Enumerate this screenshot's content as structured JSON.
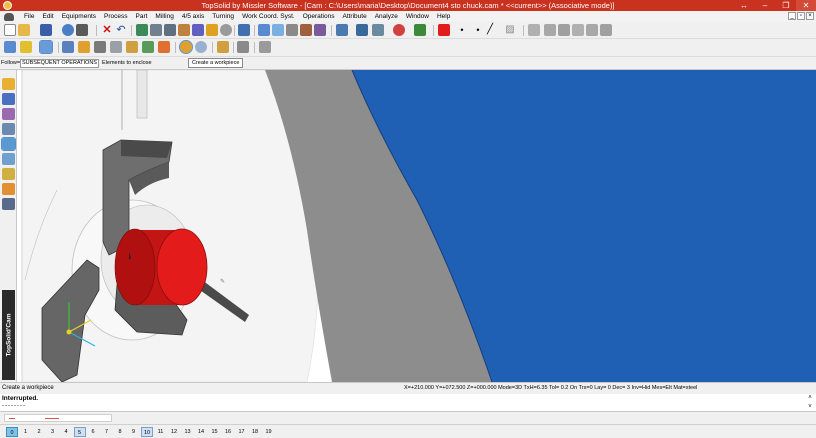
{
  "window": {
    "title": "TopSolid by Missler Software - [Cam : C:\\Users\\maria\\Desktop\\Document4 sto chuck.cam *  <<current>> (Associative mode)]",
    "controls": [
      "↔",
      "–",
      "❐",
      "✕"
    ]
  },
  "menu": {
    "items": [
      "File",
      "Edit",
      "Equipments",
      "Process",
      "Part",
      "Milling",
      "4/5 axis",
      "Turning",
      "Work Coord. Syst.",
      "Operations",
      "Attribute",
      "Analyze",
      "Window",
      "Help"
    ],
    "mdi_controls": [
      "_",
      "▫",
      "×"
    ]
  },
  "toolbar1": {
    "icons": [
      "new-file-icon",
      "open-folder-icon",
      "save-icon",
      "print-icon",
      "properties-icon",
      "delete-icon",
      "undo-icon",
      "redo-icon",
      "zoom-icon",
      "tools-icon",
      "wrench-icon",
      "eraser-icon",
      "attributes-icon",
      "measure-icon",
      "magnifier-icon",
      "fit-icon",
      "shading-icon",
      "render-icon",
      "color-icon",
      "point-icon",
      "line-style-icon",
      "hatch-icon",
      "layer-icon",
      "grid-icon"
    ],
    "current_color": "#e31b1b"
  },
  "toolbar2": {
    "icons": [
      "turning-icon",
      "flag-icon",
      "operations-icon",
      "toolpath-icon",
      "chuck-icon",
      "workpiece-icon",
      "stock-icon",
      "simulation-icon",
      "machine-icon",
      "axis-icon",
      "part-icon",
      "mirror-icon",
      "document-icon"
    ]
  },
  "follow": {
    "label": "Follow=",
    "mode": "SUBSEQUENT OPERATIONS",
    "elements_button": "Elements to enclose",
    "tooltip": "Create a workpiece"
  },
  "palette": {
    "icons": [
      "sketch-icon",
      "shape-icon",
      "edit-icon",
      "assembly-icon",
      "turning-cam-icon",
      "milling-cam-icon",
      "drill-icon",
      "tool-icon",
      "chuck-palette-icon"
    ],
    "brand": "TopSolid'Cam"
  },
  "viewport": {
    "background_color": "#1f5fb4",
    "workpiece_color": "#e31b1b",
    "chuck_color": "#7a7a7a"
  },
  "status": {
    "prompt": "Create a workpiece",
    "coords": "X=+210.000  Y=+072.500  Z=+000.000  Mode=3D  TxH=6.35   Tol= 0.2    On  Trs=0   Lay= 0   Dec= 3   Inv=Hid  Mes=Elt  Mat=steel"
  },
  "command": {
    "line1": "Interrupted.",
    "line2": "--------"
  },
  "layers": {
    "items": [
      "0",
      "1",
      "2",
      "3",
      "4",
      "5",
      "6",
      "7",
      "8",
      "9",
      "10",
      "11",
      "12",
      "13",
      "14",
      "15",
      "16",
      "17",
      "18",
      "19"
    ],
    "current": "0",
    "used": [
      "5",
      "10"
    ]
  }
}
